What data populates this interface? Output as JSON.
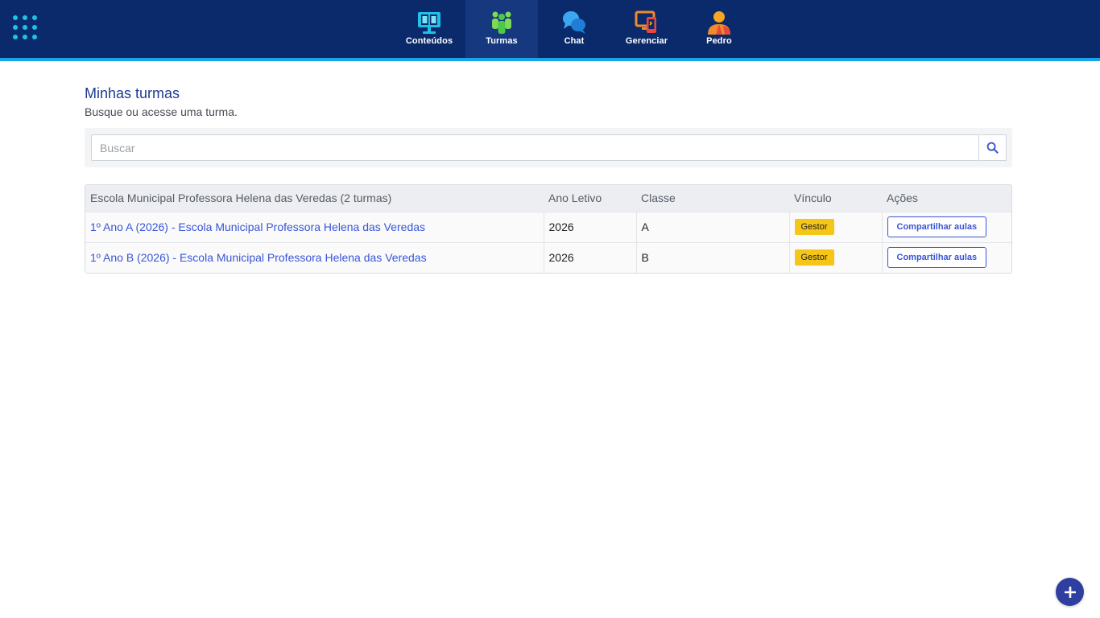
{
  "nav": {
    "apps_icon": "apps-grid-icon",
    "items": [
      {
        "label": "Conteúdos",
        "icon": "monitor-book-icon"
      },
      {
        "label": "Turmas",
        "icon": "people-group-icon"
      },
      {
        "label": "Chat",
        "icon": "chat-bubbles-icon"
      },
      {
        "label": "Gerenciar",
        "icon": "devices-manage-icon"
      },
      {
        "label": "Pedro",
        "icon": "user-avatar-icon"
      }
    ],
    "active": "Turmas"
  },
  "header": {
    "title": "Minhas turmas",
    "subtitle": "Busque ou acesse uma turma."
  },
  "search": {
    "placeholder": "Buscar",
    "value": "",
    "icon": "search-icon"
  },
  "table": {
    "headers": [
      "Escola Municipal Professora Helena das Veredas (2 turmas)",
      "Ano Letivo",
      "Classe",
      "Vínculo",
      "Ações"
    ],
    "rows": [
      {
        "turma": "1º Ano A (2026) - Escola Municipal Professora Helena das Veredas",
        "ano": "2026",
        "classe": "A",
        "vinculo": "Gestor",
        "acao": "Compartilhar aulas"
      },
      {
        "turma": "1º Ano B (2026) - Escola Municipal Professora Helena das Veredas",
        "ano": "2026",
        "classe": "B",
        "vinculo": "Gestor",
        "acao": "Compartilhar aulas"
      }
    ]
  },
  "fab": {
    "icon": "plus-icon"
  },
  "colors": {
    "topbar": "#0b2a6b",
    "accent_underline": "#1aa3e8",
    "link": "#3a55d6",
    "badge": "#f5c518",
    "title": "#1f3a93"
  }
}
